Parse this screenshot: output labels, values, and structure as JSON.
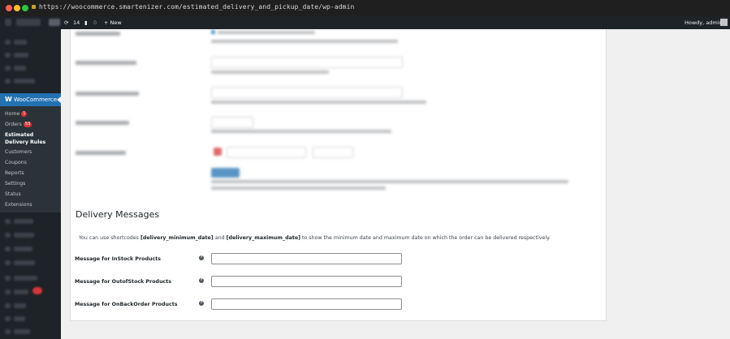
{
  "browser": {
    "url": "https://woocommerce.smartenizer.com/estimated_delivery_and_pickup_date/wp-admin",
    "traffic_colors": [
      "#ff5f57",
      "#febc2e",
      "#28c840"
    ]
  },
  "admin_bar": {
    "comments_count": "14",
    "pending_count": "0",
    "new_label": "+ New",
    "greeting": "Howdy, admin"
  },
  "sidebar": {
    "woocommerce_label": "WooCommerce",
    "submenu": [
      {
        "label": "Home",
        "badge": "1"
      },
      {
        "label": "Orders",
        "badge": "53"
      },
      {
        "label": "Estimated Delivery Rules",
        "badge": ""
      },
      {
        "label": "Customers",
        "badge": ""
      },
      {
        "label": "Coupons",
        "badge": ""
      },
      {
        "label": "Reports",
        "badge": ""
      },
      {
        "label": "Settings",
        "badge": ""
      },
      {
        "label": "Status",
        "badge": ""
      },
      {
        "label": "Extensions",
        "badge": ""
      }
    ],
    "accent_color": "#2271b1"
  },
  "delivery_messages": {
    "title": "Delivery Messages",
    "description": {
      "prefix": "You can use shortcodes ",
      "shortcode_min": "[delivery_minimum_date]",
      "middle": " and ",
      "shortcode_max": "[delivery_maximum_date]",
      "suffix": " to show the minimum date and maximum date on which the order can be delivered respectively."
    },
    "fields": [
      {
        "label": "Message for InStock Products",
        "value": "",
        "help_icon": "question-circle-icon"
      },
      {
        "label": "Message for OutofStock Products",
        "value": "",
        "help_icon": "question-circle-icon"
      },
      {
        "label": "Message for OnBackOrder Products",
        "value": "",
        "help_icon": "question-circle-icon"
      }
    ]
  }
}
